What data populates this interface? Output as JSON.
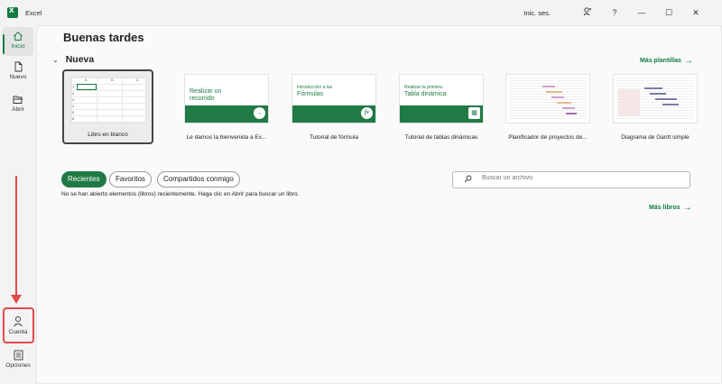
{
  "titlebar": {
    "app_name": "Excel",
    "signin": "Inic. ses.",
    "help": "?",
    "minimize": "—",
    "maximize": "☐",
    "close": "✕"
  },
  "nav": {
    "home": "Inicio",
    "new": "Nuevo",
    "open": "Abrir",
    "account": "Cuenta",
    "options": "Opciones"
  },
  "main": {
    "greeting": "Buenas tardes",
    "new_title": "Nueva",
    "more_templates": "Más plantillas",
    "templates": [
      {
        "label": "Libro en blanco"
      },
      {
        "label": "Le damos la bienvenida a Ex...",
        "thumb_text": "Realizar un recorrido"
      },
      {
        "label": "Tutorial de fórmula",
        "thumb_small": "Introducción a las",
        "thumb_text": "Fórmulas"
      },
      {
        "label": "Tutorial de tablas dinámicas",
        "thumb_small": "Realizar la primera",
        "thumb_text": "Tabla dinámica"
      },
      {
        "label": "Planificador de proyectos de..."
      },
      {
        "label": "Diagrama de Gantt simple"
      }
    ],
    "sheet_cols": [
      "A",
      "B",
      "C"
    ],
    "sheet_rows": [
      "1",
      "2",
      "3",
      "4",
      "5",
      "6",
      "7"
    ],
    "tabs": [
      "Recientes",
      "Favoritos",
      "Compartidos conmigo"
    ],
    "empty_message": "No se han abierto elementos (libros) recientemente. Haga clic en Abrir para buscar un libro.",
    "search_placeholder": "Buscar un archivo",
    "more_books": "Más libros"
  },
  "colors": {
    "accent": "#107c41",
    "annotation": "#e24a4a"
  }
}
